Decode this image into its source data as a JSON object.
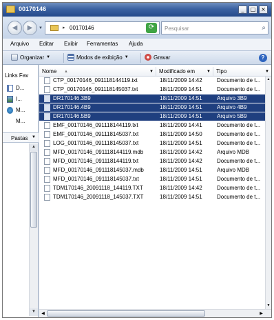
{
  "window": {
    "title": "00170146"
  },
  "address": {
    "path": "00170146",
    "search_placeholder": "Pesquisar"
  },
  "menu": [
    "Arquivo",
    "Editar",
    "Exibir",
    "Ferramentas",
    "Ajuda"
  ],
  "toolbar": {
    "organize": "Organizar",
    "views": "Modos de exibição",
    "burn": "Gravar"
  },
  "left_pane": {
    "links_header": "Links Fav",
    "links": [
      "D...",
      "I...",
      "M...",
      "M..."
    ],
    "folders_label": "Pastas"
  },
  "columns": {
    "name": "Nome",
    "modified": "Modificado em",
    "type": "Tipo"
  },
  "files": [
    {
      "name": "CTP_00170146_091118144119.txt",
      "date": "18/11/2009 14:42",
      "type": "Documento de t...",
      "selected": false
    },
    {
      "name": "CTP_00170146_091118145037.txt",
      "date": "18/11/2009 14:51",
      "type": "Documento de t...",
      "selected": false
    },
    {
      "name": "DR170146.3B9",
      "date": "18/11/2009 14:51",
      "type": "Arquivo 3B9",
      "selected": true
    },
    {
      "name": "DR170146.4B9",
      "date": "18/11/2009 14:51",
      "type": "Arquivo 4B9",
      "selected": true
    },
    {
      "name": "DR170146.5B9",
      "date": "18/11/2009 14:51",
      "type": "Arquivo 5B9",
      "selected": true
    },
    {
      "name": "EMF_00170146_091118144119.txt",
      "date": "18/11/2009 14:41",
      "type": "Documento de t...",
      "selected": false
    },
    {
      "name": "EMF_00170146_091118145037.txt",
      "date": "18/11/2009 14:50",
      "type": "Documento de t...",
      "selected": false
    },
    {
      "name": "LOG_00170146_091118145037.txt",
      "date": "18/11/2009 14:51",
      "type": "Documento de t...",
      "selected": false
    },
    {
      "name": "MFD_00170146_091118144119.mdb",
      "date": "18/11/2009 14:42",
      "type": "Arquivo MDB",
      "selected": false
    },
    {
      "name": "MFD_00170146_091118144119.txt",
      "date": "18/11/2009 14:42",
      "type": "Documento de t...",
      "selected": false
    },
    {
      "name": "MFD_00170146_091118145037.mdb",
      "date": "18/11/2009 14:51",
      "type": "Arquivo MDB",
      "selected": false
    },
    {
      "name": "MFD_00170146_091118145037.txt",
      "date": "18/11/2009 14:51",
      "type": "Documento de t...",
      "selected": false
    },
    {
      "name": "TDM170146_20091118_144119.TXT",
      "date": "18/11/2009 14:42",
      "type": "Documento de t...",
      "selected": false
    },
    {
      "name": "TDM170146_20091118_145037.TXT",
      "date": "18/11/2009 14:51",
      "type": "Documento de t...",
      "selected": false
    }
  ]
}
